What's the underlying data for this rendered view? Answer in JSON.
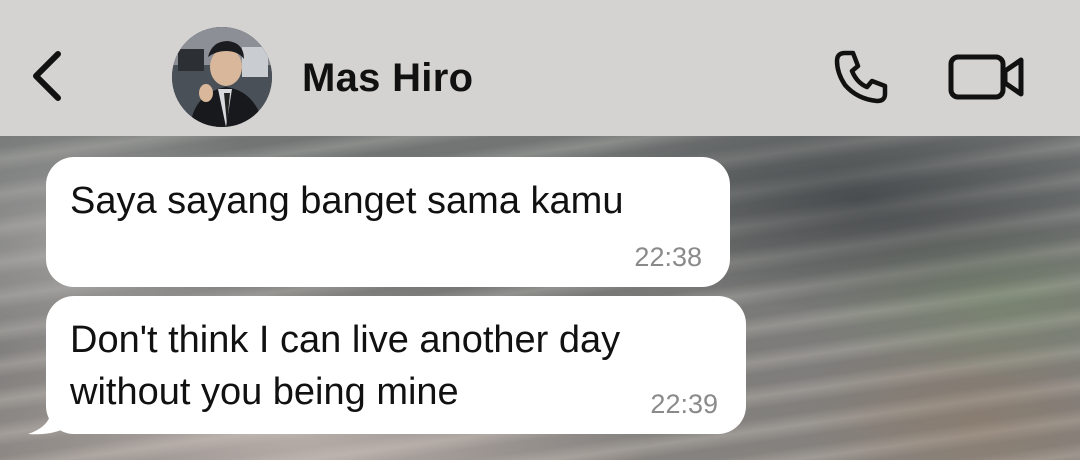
{
  "header": {
    "back_icon": "chevron-left-icon",
    "contact_name": "Mas Hiro",
    "call_icon": "phone-icon",
    "video_icon": "video-camera-icon"
  },
  "messages": [
    {
      "text": "Saya sayang banget sama kamu",
      "time": "22:38"
    },
    {
      "text": "Don't think I can live another day\nwithout you being mine",
      "time": "22:39"
    }
  ],
  "colors": {
    "header_bg": "#d4d3d2",
    "bubble_bg": "#ffffff",
    "timestamp": "#8a8a8a",
    "text": "#111111"
  }
}
